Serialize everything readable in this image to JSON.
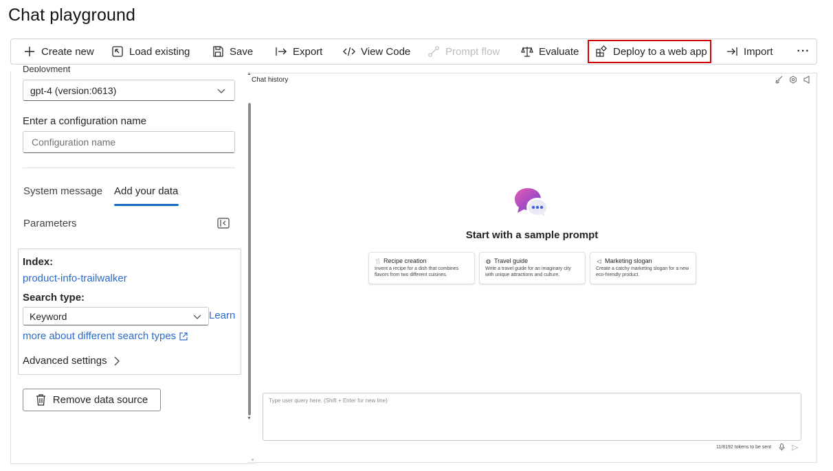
{
  "page": {
    "title": "Chat playground"
  },
  "toolbar": {
    "create_new": "Create new",
    "load_existing": "Load existing",
    "save": "Save",
    "export": "Export",
    "view_code": "View Code",
    "prompt_flow": "Prompt flow",
    "evaluate": "Evaluate",
    "deploy": "Deploy to a web app",
    "import": "Import",
    "more": "···"
  },
  "config": {
    "deployment_label": "Deployment",
    "deployment_value": "gpt-4 (version:0613)",
    "name_label": "Enter a configuration name",
    "name_placeholder": "Configuration name",
    "name_value": ""
  },
  "tabs": {
    "system_message": "System message",
    "add_your_data": "Add your data",
    "active": "add_your_data"
  },
  "parameters": {
    "label": "Parameters"
  },
  "data_source": {
    "index_label": "Index:",
    "index_value": "product-info-trailwalker",
    "search_type_label": "Search type:",
    "search_type_value": "Keyword",
    "learn_more_1": "Learn",
    "learn_more_2": "more about different search types",
    "advanced_settings": "Advanced settings",
    "remove_button": "Remove data source"
  },
  "chat": {
    "history_label": "Chat history",
    "start_title": "Start with a sample prompt",
    "sample_prompts": [
      {
        "icon": "recipe-icon",
        "title": "Recipe creation",
        "description": "Invent a recipe for a dish that combines flavors from two different cuisines."
      },
      {
        "icon": "globe-icon",
        "title": "Travel guide",
        "description": "Write a travel guide for an imaginary city with unique attractions and culture."
      },
      {
        "icon": "megaphone-icon",
        "title": "Marketing slogan",
        "description": "Create a catchy marketing slogan for a new eco-friendly product."
      }
    ],
    "input_placeholder": "Type user query here. (Shift + Enter for new line)",
    "token_count": "11/8192 tokens to be sent"
  },
  "colors": {
    "accent": "#0f6cbd",
    "link": "#2a6bc9",
    "highlight_border": "#d20000",
    "disabled_text": "#bdbdbd"
  }
}
